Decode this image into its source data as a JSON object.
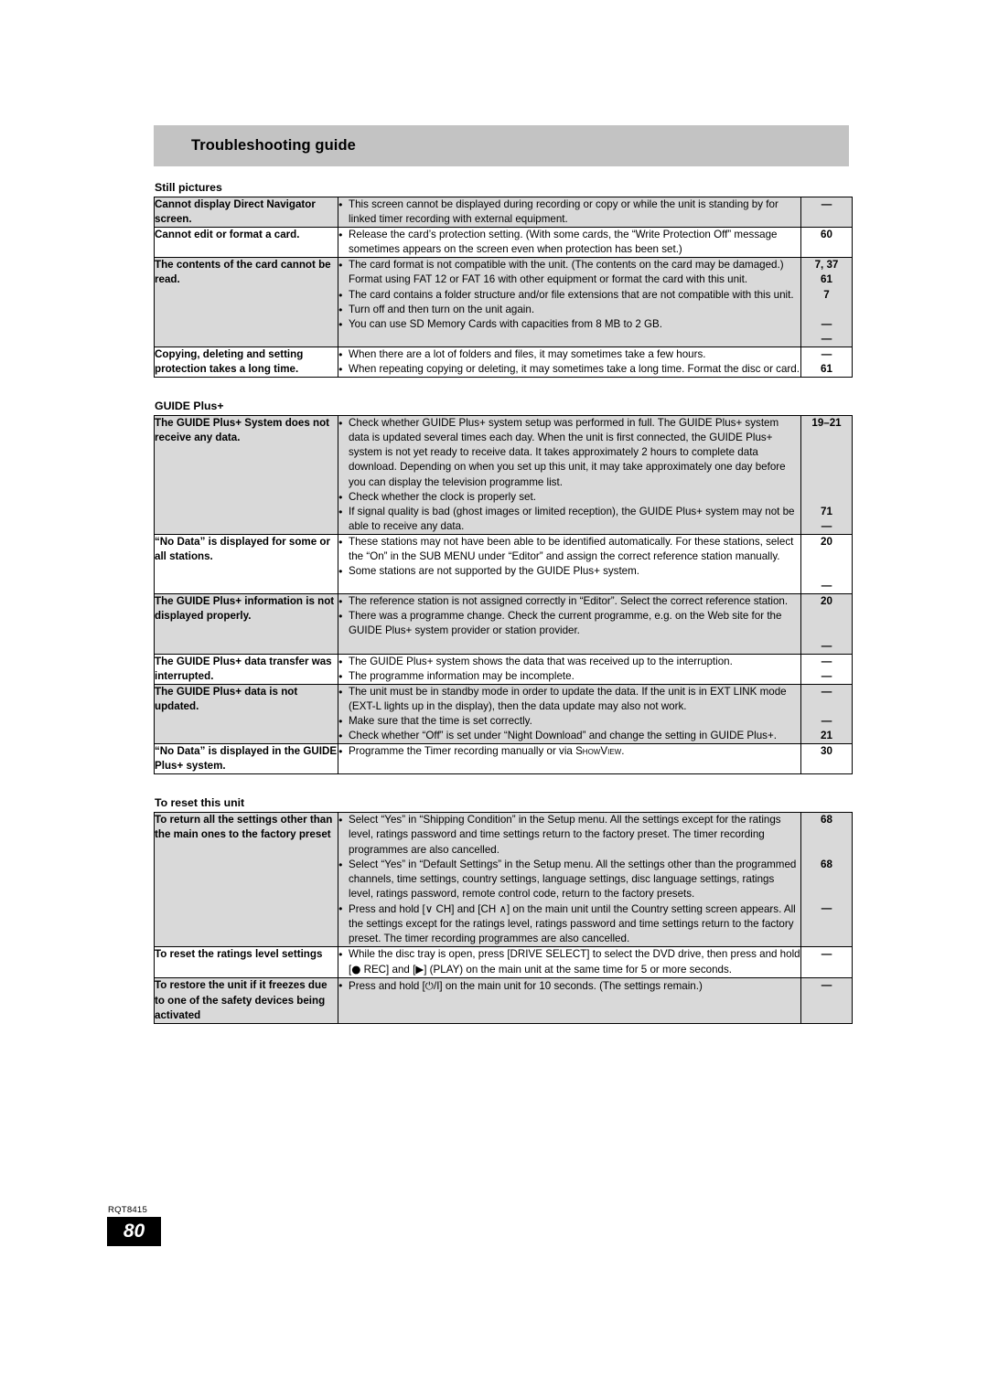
{
  "header": {
    "chapter_title": "Troubleshooting guide"
  },
  "footer": {
    "code": "RQT8415",
    "page_number": "80"
  },
  "sections": [
    {
      "label": "Still pictures",
      "rows": [
        {
          "symptom": "Cannot display Direct Navigator screen.",
          "items": [
            "This screen cannot be displayed during recording or copy or while the unit is standing by for linked timer recording with external equipment."
          ],
          "refs": [
            "—"
          ]
        },
        {
          "symptom": "Cannot edit or format a card.",
          "items": [
            "Release the card’s protection setting. (With some cards, the “Write Protection Off” message sometimes appears on the screen even when protection has been set.)"
          ],
          "refs": [
            "60"
          ]
        },
        {
          "symptom": "The contents of the card cannot be read.",
          "items": [
            "The card format is not compatible with the unit. (The contents on the card may be damaged.) Format using FAT 12 or FAT 16 with other equipment or format the card with this unit.",
            "The card contains a folder structure and/or file extensions that are not compatible with this unit.",
            "Turn off and then turn on the unit again.",
            "You can use SD Memory Cards with capacities from 8 MB to 2 GB."
          ],
          "refs": [
            "7, 37",
            "61",
            "7",
            "",
            "—",
            "—"
          ]
        },
        {
          "symptom": "Copying, deleting and setting protection takes a long time.",
          "items": [
            "When there are a lot of folders and files, it may sometimes take a few hours.",
            "When repeating copying or deleting, it may sometimes take a long time. Format the disc or card."
          ],
          "refs": [
            "—",
            "61"
          ]
        }
      ]
    },
    {
      "label": "GUIDE Plus+",
      "rows": [
        {
          "symptom": "The GUIDE Plus+ System does not receive any data.",
          "items": [
            "Check whether GUIDE Plus+ system setup was performed in full. The GUIDE Plus+ system data is updated several times each day. When the unit is first connected, the GUIDE Plus+ system is not yet ready to receive data. It takes approximately 2 hours to complete data download. Depending on when you set up this unit, it may take approximately one day before you can display the television programme list.",
            "Check whether the clock is properly set.",
            "If signal quality is bad (ghost images or limited reception), the GUIDE Plus+ system may not be able to receive any data."
          ],
          "refs": [
            "19–21",
            "",
            "",
            "",
            "",
            "",
            "71",
            "—"
          ]
        },
        {
          "symptom": "“No Data” is displayed for some or all stations.",
          "items": [
            "These stations may not have been able to be identified automatically. For these stations, select the “On” in the SUB MENU under “Editor” and assign the correct reference station manually.",
            "Some stations are not supported by the GUIDE Plus+ system."
          ],
          "refs": [
            "20",
            "",
            "",
            "—"
          ]
        },
        {
          "symptom": "The GUIDE Plus+ information is not displayed properly.",
          "items": [
            "The reference station is not assigned correctly in “Editor”. Select the correct reference station.",
            "There was a programme change. Check the current programme, e.g. on the Web site for the GUIDE Plus+ system provider or station provider."
          ],
          "refs": [
            "20",
            "",
            "",
            "—"
          ]
        },
        {
          "symptom": "The GUIDE Plus+ data transfer was interrupted.",
          "items": [
            "The GUIDE Plus+ system shows the data that was received up to the interruption.",
            "The programme information may be incomplete."
          ],
          "refs": [
            "—",
            "—"
          ]
        },
        {
          "symptom": "The GUIDE Plus+ data is not updated.",
          "items": [
            "The unit must be in standby mode in order to update the data. If the unit is in EXT LINK mode (EXT-L lights up in the display), then the data update may also not work.",
            "Make sure that the time is set correctly.",
            "Check whether “Off” is set under “Night Download” and change the setting in GUIDE Plus+."
          ],
          "refs": [
            "—",
            "",
            "—",
            "21"
          ]
        },
        {
          "symptom": "“No Data” is displayed in the GUIDE Plus+ system.",
          "items": [
            "Programme the Timer recording manually or via SHOWVIEW."
          ],
          "refs": [
            "30"
          ]
        }
      ]
    },
    {
      "label": "To reset this unit",
      "rows": [
        {
          "symptom": "To return all the settings other than the main ones to the factory preset",
          "items": [
            "Select “Yes” in “Shipping Condition” in the Setup menu. All the settings except for the ratings level, ratings password and time settings return to the factory preset. The timer recording programmes are also cancelled.",
            "Select “Yes” in “Default Settings” in the Setup menu. All the settings other than the programmed channels, time settings, country settings, language settings, disc language settings, ratings level, ratings password, remote control code, return to the factory presets.",
            "Press and hold [∨ CH] and [CH ∧] on the main unit until the Country setting screen appears. All the settings except for the ratings level, ratings password and time settings return to the factory preset. The timer recording programmes are also cancelled."
          ],
          "refs": [
            "68",
            "",
            "",
            "68",
            "",
            "",
            "—"
          ]
        },
        {
          "symptom": "To reset the ratings level settings",
          "items": [
            "While the disc tray is open, press [DRIVE SELECT] to select the DVD drive, then press and hold [● REC] and [▶] (PLAY) on the main unit at the same time for 5 or more seconds."
          ],
          "refs": [
            "—"
          ]
        },
        {
          "symptom": "To restore the unit if it freezes due to one of the safety devices being activated",
          "items": [
            "Press and hold [⏻/I] on the main unit for 10 seconds. (The settings remain.)"
          ],
          "refs": [
            "—"
          ]
        }
      ]
    }
  ]
}
